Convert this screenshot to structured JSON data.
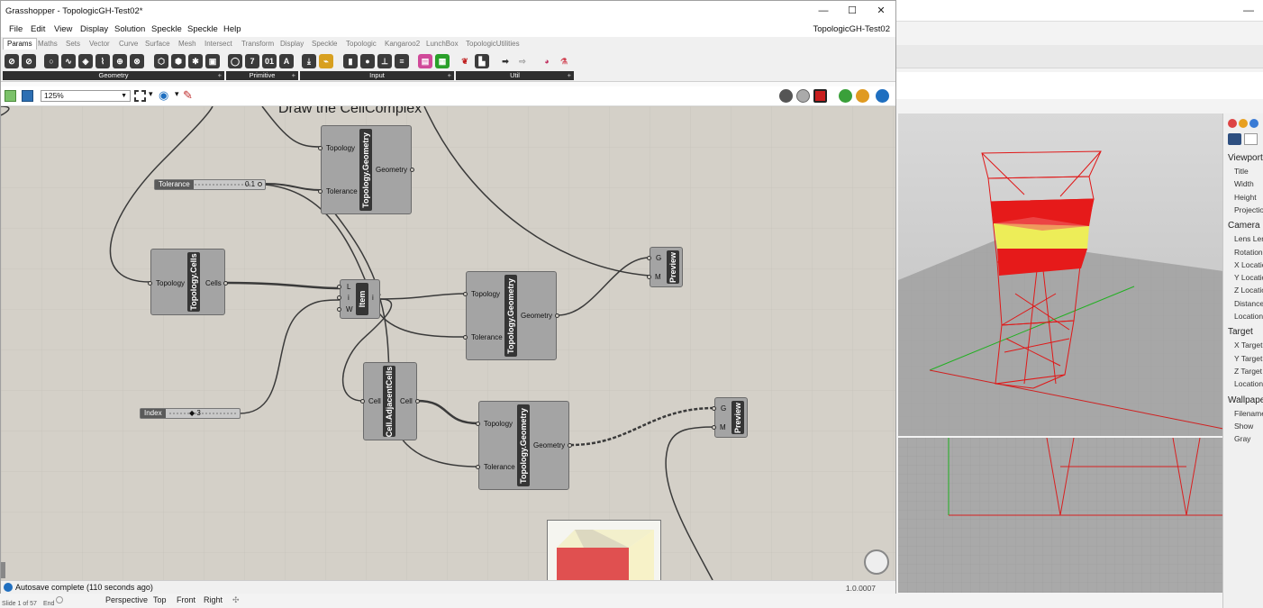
{
  "window": {
    "title": "Grasshopper - TopologicGH-Test02*",
    "doc_name": "TopologicGH-Test02"
  },
  "menu": [
    "File",
    "Edit",
    "View",
    "Display",
    "Solution",
    "Speckle",
    "Speckle",
    "Help"
  ],
  "tabs": [
    "Params",
    "Maths",
    "Sets",
    "Vector",
    "Curve",
    "Surface",
    "Mesh",
    "Intersect",
    "Transform",
    "Display",
    "Speckle",
    "Topologic",
    "Kangaroo2",
    "LunchBox",
    "TopologicUtilities"
  ],
  "active_tab": "Params",
  "ribbon_groups": [
    "Geometry",
    "Primitive",
    "Input",
    "Util"
  ],
  "zoom": "125%",
  "canvas": {
    "group_title": "Draw the CellComplex",
    "tolerance_slider": {
      "label": "Tolerance",
      "value": "0.1"
    },
    "index_slider": {
      "label": "Index",
      "value": "◆ 3"
    },
    "components": {
      "geom_top": {
        "name": "Topology.Geometry",
        "inputs": [
          "Topology",
          "Tolerance"
        ],
        "output": "Geometry"
      },
      "cells": {
        "name": "Topology.Cells",
        "input": "Topology",
        "output": "Cells"
      },
      "item": {
        "name": "Item",
        "inputs": [
          "L",
          "i",
          "W"
        ],
        "output": "i"
      },
      "geom_mid": {
        "name": "Topology.Geometry",
        "inputs": [
          "Topology",
          "Tolerance"
        ],
        "output": "Geometry"
      },
      "adjacent": {
        "name": "Cell.AdjacentCells",
        "input": "Cell",
        "output": "Cell"
      },
      "geom_bottom": {
        "name": "Topology.Geometry",
        "inputs": [
          "Topology",
          "Tolerance"
        ],
        "output": "Geometry"
      },
      "preview_top": {
        "name": "Preview",
        "inputs": [
          "G",
          "M"
        ]
      },
      "preview_bottom": {
        "name": "Preview",
        "inputs": [
          "G",
          "M"
        ]
      }
    }
  },
  "status": {
    "text": "Autosave complete (110 seconds ago)",
    "version": "1.0.0007"
  },
  "rhino": {
    "properties": {
      "sections": [
        {
          "title": "Viewport",
          "items": [
            "Title",
            "Width",
            "Height",
            "Projection"
          ]
        },
        {
          "title": "Camera",
          "items": [
            "Lens Length",
            "Rotation",
            "X Location",
            "Y Location",
            "Z Location",
            "Distance",
            "Location"
          ]
        },
        {
          "title": "Target",
          "items": [
            "X Target",
            "Y Target",
            "Z Target",
            "Location"
          ]
        },
        {
          "title": "Wallpaper",
          "items": [
            "Filename",
            "Show",
            "Gray"
          ]
        }
      ]
    },
    "viewport_tabs": [
      "Perspective",
      "Top",
      "Front",
      "Right"
    ],
    "command_line": {
      "slide": "Slide 1 of 57",
      "end": "End"
    }
  },
  "colors": {
    "canvas": "#d4d0c8",
    "component": "#a4a4a4",
    "nickname": "#353535",
    "viewport_red": "#e01818",
    "viewport_yellow": "#eeee55"
  }
}
